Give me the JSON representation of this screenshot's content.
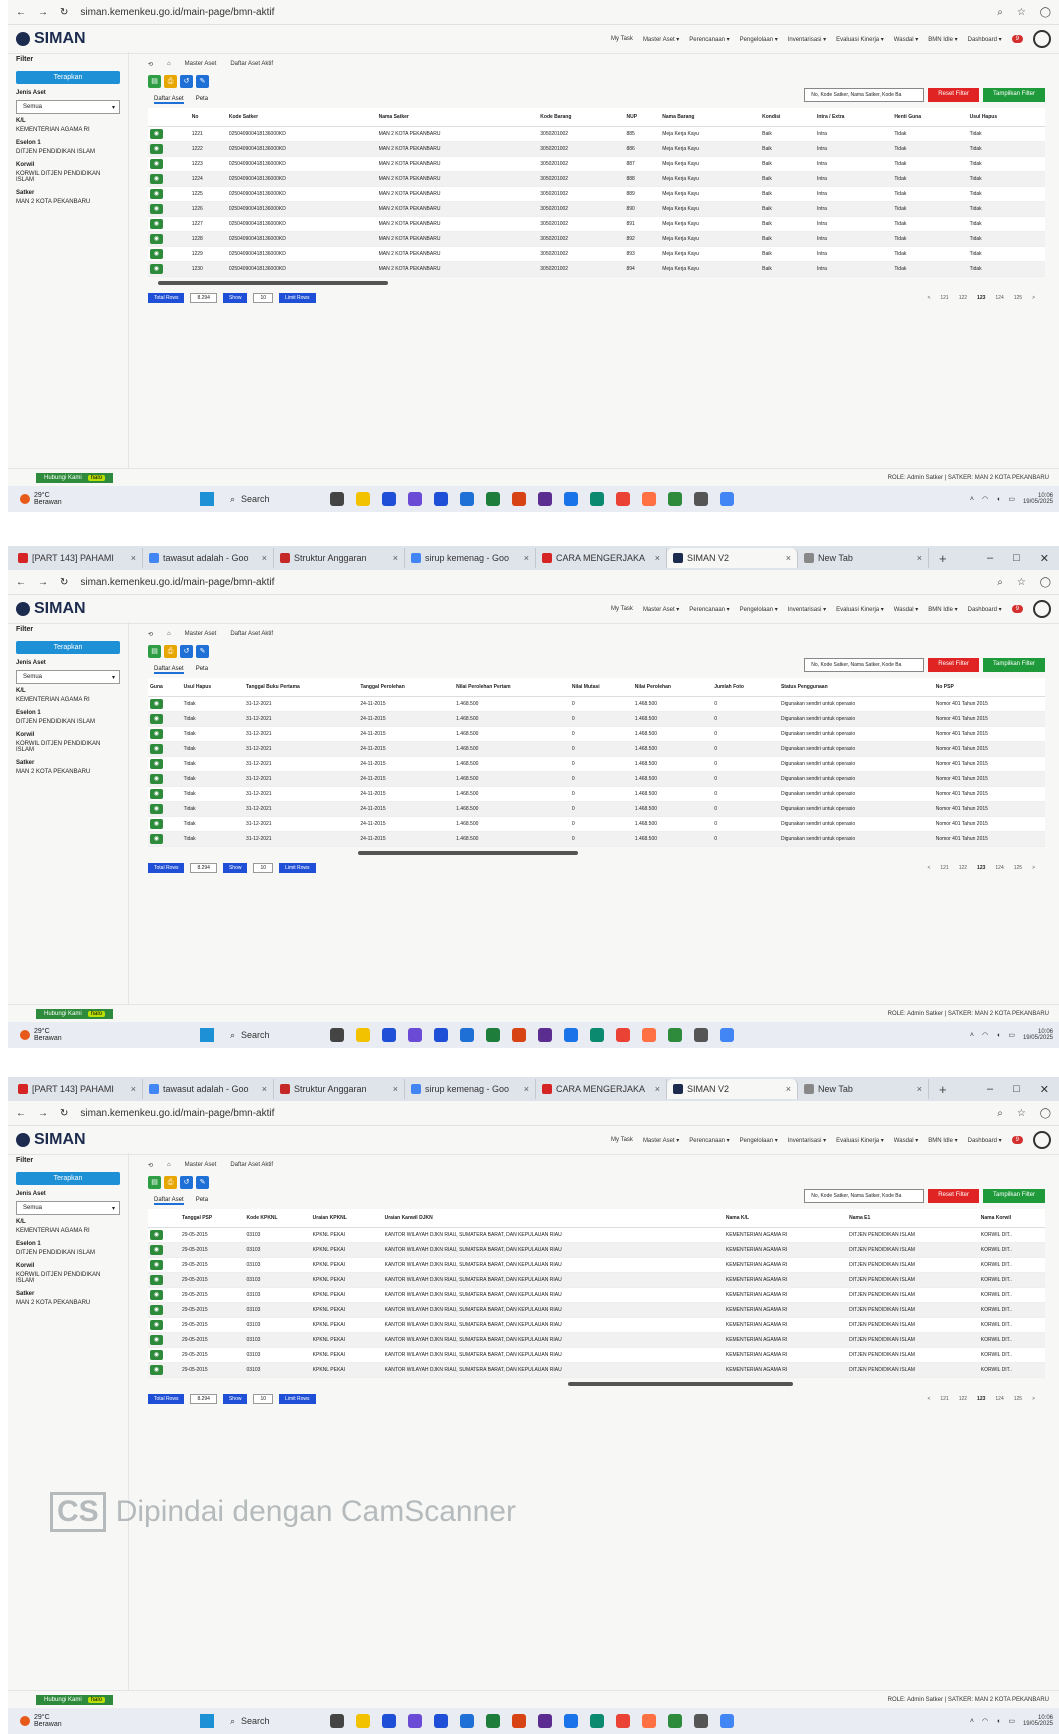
{
  "browser": {
    "tabs": [
      {
        "label": "[PART 143] PAHAMI",
        "color": "#d62424"
      },
      {
        "label": "tawasut adalah - Goo",
        "color": "#4285f4"
      },
      {
        "label": "Struktur Anggaran",
        "color": "#c62828"
      },
      {
        "label": "sirup kemenag - Goo",
        "color": "#4285f4"
      },
      {
        "label": "CARA MENGERJAKA",
        "color": "#d62424"
      },
      {
        "label": "SIMAN V2",
        "color": "#1d2b4f"
      },
      {
        "label": "New Tab",
        "color": "#888888"
      }
    ],
    "new_tab_symbol": "+",
    "url": "siman.kemenkeu.go.id/main-page/bmn-aktif"
  },
  "app": {
    "logo": "SIMAN",
    "nav": [
      "My Task",
      "Master Aset ▾",
      "Perencanaan ▾",
      "Pengelolaan ▾",
      "Inventarisasi ▾",
      "Evaluasi Kinerja ▾",
      "Wasdal ▾",
      "BMN Idle ▾",
      "Dashboard ▾"
    ],
    "notif_count": "9"
  },
  "sidebar": {
    "filter_title": "Filter",
    "apply_label": "Terapkan",
    "jenis_aset_label": "Jenis Aset",
    "jenis_aset_value": "Semua",
    "fields": [
      {
        "label": "K/L",
        "value": "KEMENTERIAN AGAMA RI"
      },
      {
        "label": "Eselon 1",
        "value": "DITJEN PENDIDIKAN ISLAM"
      },
      {
        "label": "Korwil",
        "value": "KORWIL DITJEN PENDIDIKAN ISLAM"
      },
      {
        "label": "Satker",
        "value": "MAN 2 KOTA PEKANBARU"
      }
    ]
  },
  "content": {
    "breadcrumb": [
      "Master Aset",
      "Daftar Aset Aktif"
    ],
    "search_placeholder": "No, Kode Satker, Nama Satker, Kode Ba",
    "reset_label": "Reset Filter",
    "show_filter_label": "Tampilkan Filter",
    "subtabs": [
      "Daftar Aset",
      "Peta"
    ],
    "total_rows_label": "Total Rows",
    "total_rows_value": "8.294",
    "show_label": "Show",
    "show_value": "10",
    "limit_rows_label": "Limit Rows",
    "pages": [
      "<",
      "121",
      "122",
      "123",
      "124",
      "125",
      ">"
    ],
    "current_page": "123"
  },
  "tables": [
    {
      "headers": [
        "",
        "No",
        "Kode Satker",
        "Nama Satker",
        "Kode Barang",
        "NUP",
        "Nama Barang",
        "Kondisi",
        "Intra / Extra",
        "Henti Guna",
        "Usul Hapus"
      ],
      "rows": [
        [
          "1221",
          "025040900418136000KD",
          "MAN 2 KOTA PEKANBARU",
          "3050201002",
          "885",
          "Meja Kerja Kayu",
          "Baik",
          "Intra",
          "Tidak",
          "Tidak"
        ],
        [
          "1222",
          "025040900418136000KD",
          "MAN 2 KOTA PEKANBARU",
          "3050201002",
          "886",
          "Meja Kerja Kayu",
          "Baik",
          "Intra",
          "Tidak",
          "Tidak"
        ],
        [
          "1223",
          "025040900418136000KD",
          "MAN 2 KOTA PEKANBARU",
          "3050201002",
          "887",
          "Meja Kerja Kayu",
          "Baik",
          "Intra",
          "Tidak",
          "Tidak"
        ],
        [
          "1224",
          "025040900418136000KD",
          "MAN 2 KOTA PEKANBARU",
          "3050201002",
          "888",
          "Meja Kerja Kayu",
          "Baik",
          "Intra",
          "Tidak",
          "Tidak"
        ],
        [
          "1225",
          "025040900418136000KD",
          "MAN 2 KOTA PEKANBARU",
          "3050201002",
          "889",
          "Meja Kerja Kayu",
          "Baik",
          "Intra",
          "Tidak",
          "Tidak"
        ],
        [
          "1226",
          "025040900418136000KD",
          "MAN 2 KOTA PEKANBARU",
          "3050201002",
          "890",
          "Meja Kerja Kayu",
          "Baik",
          "Intra",
          "Tidak",
          "Tidak"
        ],
        [
          "1227",
          "025040900418136000KD",
          "MAN 2 KOTA PEKANBARU",
          "3050201002",
          "891",
          "Meja Kerja Kayu",
          "Baik",
          "Intra",
          "Tidak",
          "Tidak"
        ],
        [
          "1228",
          "025040900418136000KD",
          "MAN 2 KOTA PEKANBARU",
          "3050201002",
          "892",
          "Meja Kerja Kayu",
          "Baik",
          "Intra",
          "Tidak",
          "Tidak"
        ],
        [
          "1229",
          "025040900418136000KD",
          "MAN 2 KOTA PEKANBARU",
          "3050201002",
          "893",
          "Meja Kerja Kayu",
          "Baik",
          "Intra",
          "Tidak",
          "Tidak"
        ],
        [
          "1230",
          "025040900418136000KD",
          "MAN 2 KOTA PEKANBARU",
          "3050201002",
          "894",
          "Meja Kerja Kayu",
          "Baik",
          "Intra",
          "Tidak",
          "Tidak"
        ]
      ]
    },
    {
      "headers": [
        "Guna",
        "Usul Hapus",
        "Tanggal Buku Pertama",
        "Tanggal Perolehan",
        "Nilai Perolehan Pertam",
        "Nilai Mutasi",
        "Nilai Perolehan",
        "Jumlah Foto",
        "Status Penggunaan",
        "No PSP"
      ],
      "rows": [
        [
          "Tidak",
          "31-12-2021",
          "24-11-2015",
          "1.468.500",
          "0",
          "1.468.500",
          "0",
          "Digunakan sendiri untuk operasio",
          "Nomor 401 Tahun 2015"
        ],
        [
          "Tidak",
          "31-12-2021",
          "24-11-2015",
          "1.468.500",
          "0",
          "1.468.500",
          "0",
          "Digunakan sendiri untuk operasio",
          "Nomor 401 Tahun 2015"
        ],
        [
          "Tidak",
          "31-12-2021",
          "24-11-2015",
          "1.468.500",
          "0",
          "1.468.500",
          "0",
          "Digunakan sendiri untuk operasio",
          "Nomor 401 Tahun 2015"
        ],
        [
          "Tidak",
          "31-12-2021",
          "24-11-2015",
          "1.468.500",
          "0",
          "1.468.500",
          "0",
          "Digunakan sendiri untuk operasio",
          "Nomor 401 Tahun 2015"
        ],
        [
          "Tidak",
          "31-12-2021",
          "24-11-2015",
          "1.468.500",
          "0",
          "1.468.500",
          "0",
          "Digunakan sendiri untuk operasio",
          "Nomor 401 Tahun 2015"
        ],
        [
          "Tidak",
          "31-12-2021",
          "24-11-2015",
          "1.468.500",
          "0",
          "1.468.500",
          "0",
          "Digunakan sendiri untuk operasio",
          "Nomor 401 Tahun 2015"
        ],
        [
          "Tidak",
          "31-12-2021",
          "24-11-2015",
          "1.468.500",
          "0",
          "1.468.500",
          "0",
          "Digunakan sendiri untuk operasio",
          "Nomor 401 Tahun 2015"
        ],
        [
          "Tidak",
          "31-12-2021",
          "24-11-2015",
          "1.468.500",
          "0",
          "1.468.500",
          "0",
          "Digunakan sendiri untuk operasio",
          "Nomor 401 Tahun 2015"
        ],
        [
          "Tidak",
          "31-12-2021",
          "24-11-2015",
          "1.468.500",
          "0",
          "1.468.500",
          "0",
          "Digunakan sendiri untuk operasio",
          "Nomor 401 Tahun 2015"
        ],
        [
          "Tidak",
          "31-12-2021",
          "24-11-2015",
          "1.468.500",
          "0",
          "1.468.500",
          "0",
          "Digunakan sendiri untuk operasio",
          "Nomor 401 Tahun 2015"
        ]
      ]
    },
    {
      "headers": [
        "",
        "Tanggal PSP",
        "Kode KPKNL",
        "Uraian KPKNL",
        "Uraian Kanwil DJKN",
        "Nama K/L",
        "Nama E1",
        "Nama Korwil"
      ],
      "rows": [
        [
          "29-05-2015",
          "03103",
          "KPKNL PEKAI",
          "KANTOR WILAYAH DJKN RIAU, SUMATERA BARAT, DAN KEPULAUAN RIAU",
          "KEMENTERIAN AGAMA RI",
          "DITJEN PENDIDIKAN ISLAM",
          "KORWIL DIT.."
        ],
        [
          "29-05-2015",
          "03103",
          "KPKNL PEKAI",
          "KANTOR WILAYAH DJKN RIAU, SUMATERA BARAT, DAN KEPULAUAN RIAU",
          "KEMENTERIAN AGAMA RI",
          "DITJEN PENDIDIKAN ISLAM",
          "KORWIL DIT.."
        ],
        [
          "29-05-2015",
          "03103",
          "KPKNL PEKAI",
          "KANTOR WILAYAH DJKN RIAU, SUMATERA BARAT, DAN KEPULAUAN RIAU",
          "KEMENTERIAN AGAMA RI",
          "DITJEN PENDIDIKAN ISLAM",
          "KORWIL DIT.."
        ],
        [
          "29-05-2015",
          "03103",
          "KPKNL PEKAI",
          "KANTOR WILAYAH DJKN RIAU, SUMATERA BARAT, DAN KEPULAUAN RIAU",
          "KEMENTERIAN AGAMA RI",
          "DITJEN PENDIDIKAN ISLAM",
          "KORWIL DIT.."
        ],
        [
          "29-05-2015",
          "03103",
          "KPKNL PEKAI",
          "KANTOR WILAYAH DJKN RIAU, SUMATERA BARAT, DAN KEPULAUAN RIAU",
          "KEMENTERIAN AGAMA RI",
          "DITJEN PENDIDIKAN ISLAM",
          "KORWIL DIT.."
        ],
        [
          "29-05-2015",
          "03103",
          "KPKNL PEKAI",
          "KANTOR WILAYAH DJKN RIAU, SUMATERA BARAT, DAN KEPULAUAN RIAU",
          "KEMENTERIAN AGAMA RI",
          "DITJEN PENDIDIKAN ISLAM",
          "KORWIL DIT.."
        ],
        [
          "29-05-2015",
          "03103",
          "KPKNL PEKAI",
          "KANTOR WILAYAH DJKN RIAU, SUMATERA BARAT, DAN KEPULAUAN RIAU",
          "KEMENTERIAN AGAMA RI",
          "DITJEN PENDIDIKAN ISLAM",
          "KORWIL DIT.."
        ],
        [
          "29-05-2015",
          "03103",
          "KPKNL PEKAI",
          "KANTOR WILAYAH DJKN RIAU, SUMATERA BARAT, DAN KEPULAUAN RIAU",
          "KEMENTERIAN AGAMA RI",
          "DITJEN PENDIDIKAN ISLAM",
          "KORWIL DIT.."
        ],
        [
          "29-05-2015",
          "03103",
          "KPKNL PEKAI",
          "KANTOR WILAYAH DJKN RIAU, SUMATERA BARAT, DAN KEPULAUAN RIAU",
          "KEMENTERIAN AGAMA RI",
          "DITJEN PENDIDIKAN ISLAM",
          "KORWIL DIT.."
        ],
        [
          "29-05-2015",
          "03103",
          "KPKNL PEKAI",
          "KANTOR WILAYAH DJKN RIAU, SUMATERA BARAT, DAN KEPULAUAN RIAU",
          "KEMENTERIAN AGAMA RI",
          "DITJEN PENDIDIKAN ISLAM",
          "KORWIL DIT.."
        ]
      ]
    }
  ],
  "footer": {
    "contact_label": "Hubungi Kami",
    "contact_badge": "halo",
    "role_info": "ROLE: Admin Satker | SATKER: MAN 2 KOTA PEKANBARU"
  },
  "taskbar": {
    "temp": "29°C",
    "weather": "Berawan",
    "search_label": "Search",
    "time": "10:06",
    "date": "19/05/2025"
  },
  "watermark": {
    "logo": "CS",
    "text": "Dipindai dengan CamScanner"
  }
}
